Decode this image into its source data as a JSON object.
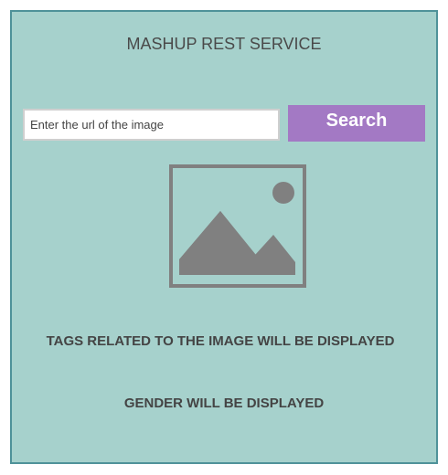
{
  "header": {
    "title": "MASHUP REST SERVICE"
  },
  "search": {
    "placeholder": "Enter the url of the image",
    "button_label": "Search"
  },
  "image": {
    "icon": "image-placeholder-icon"
  },
  "results": {
    "tags_text": "TAGS RELATED TO THE IMAGE WILL BE DISPLAYED",
    "gender_text": "GENDER WILL BE DISPLAYED"
  },
  "colors": {
    "background": "#a6d1cc",
    "border": "#4f9299",
    "button": "#a379c4",
    "icon": "#808080"
  }
}
